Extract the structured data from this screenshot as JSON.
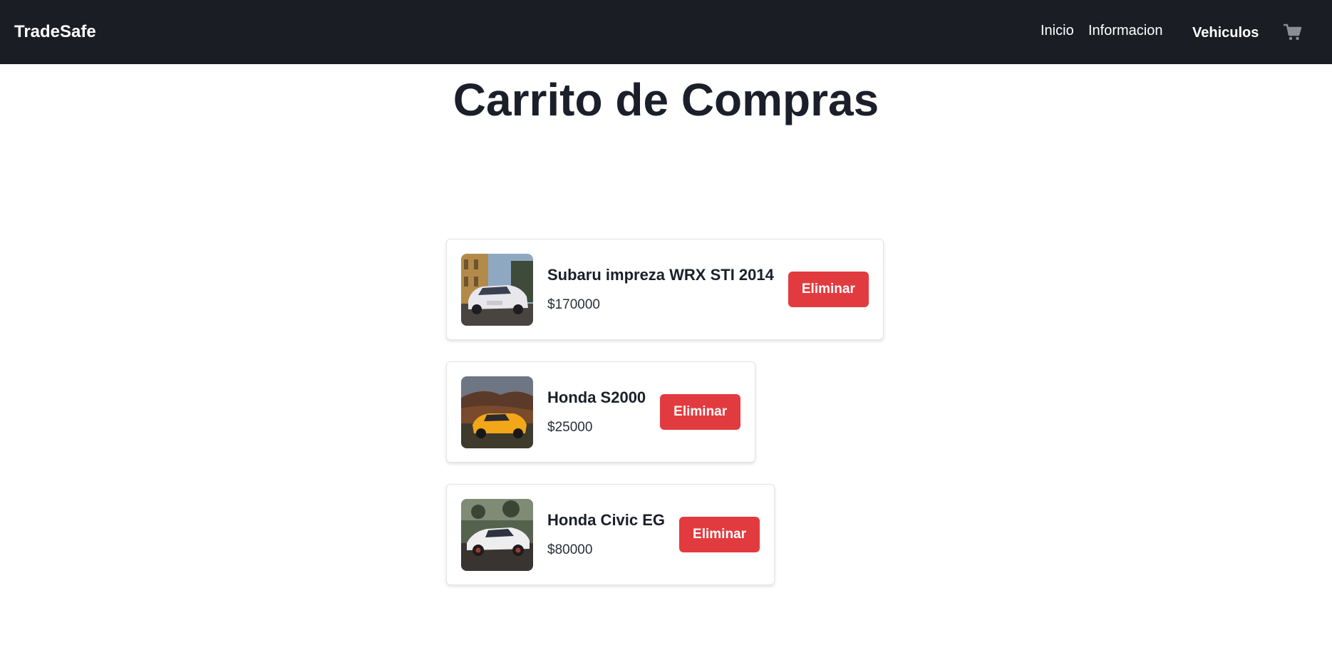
{
  "navbar": {
    "brand": "TradeSafe",
    "links": {
      "inicio": "Inicio",
      "informacion": "Informacion",
      "vehiculos": "Vehiculos"
    },
    "cart_icon": "shopping-cart-icon",
    "background_color": "#1b1d25"
  },
  "page": {
    "title": "Carrito de Compras"
  },
  "cart": {
    "items": [
      {
        "name": "Subaru impreza WRX STI 2014",
        "price": "$170000",
        "remove_label": "Eliminar",
        "image": "white-subaru-photo"
      },
      {
        "name": "Honda S2000",
        "price": "$25000",
        "remove_label": "Eliminar",
        "image": "yellow-honda-s2000-photo"
      },
      {
        "name": "Honda Civic EG",
        "price": "$80000",
        "remove_label": "Eliminar",
        "image": "white-honda-civic-photo"
      }
    ],
    "remove_button_color": "#e23b3f"
  }
}
